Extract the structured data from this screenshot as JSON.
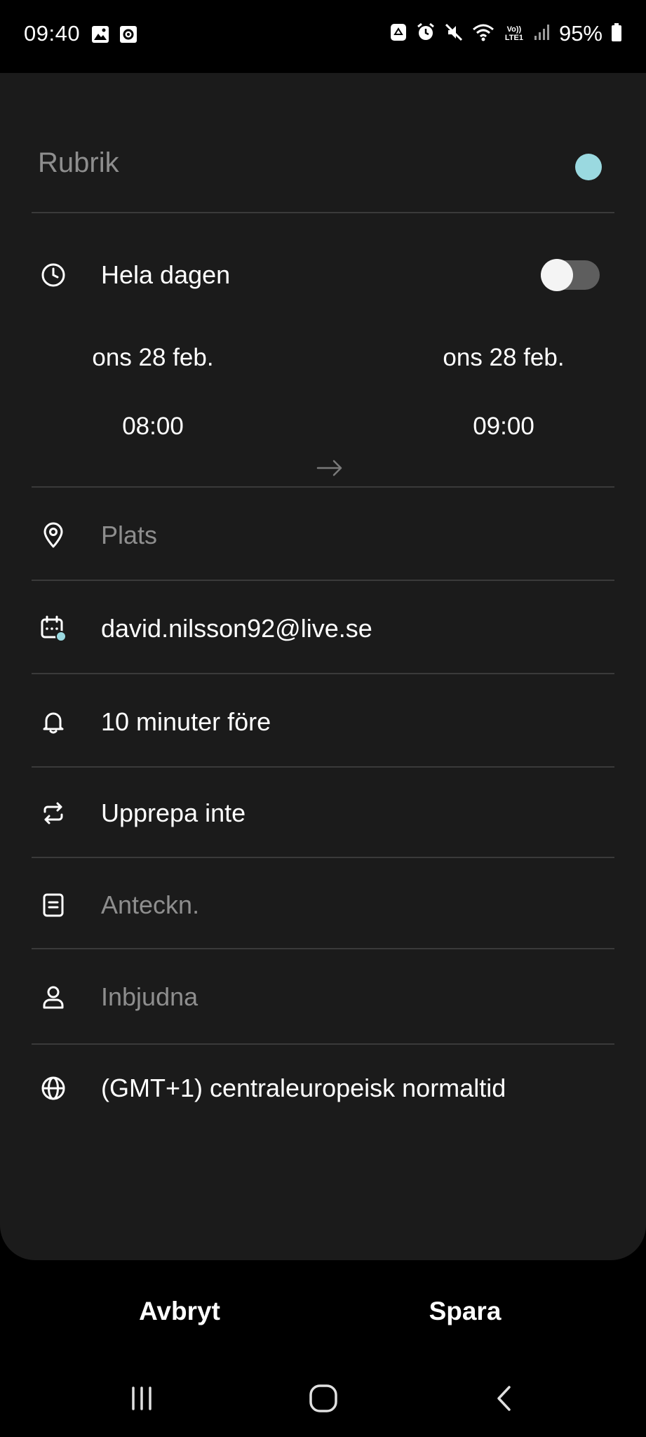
{
  "status_bar": {
    "time": "09:40",
    "battery": "95%",
    "left_icons": [
      "gallery-icon",
      "screen-record-icon"
    ],
    "right_icons": [
      "recycle-icon",
      "alarm-icon",
      "mute-icon",
      "wifi-icon",
      "volte-lte-icon",
      "signal-icon",
      "battery-icon"
    ],
    "volte_label": "Vo)) LTE1"
  },
  "event": {
    "title_placeholder": "Rubrik",
    "color": "#9ad9e0",
    "all_day": {
      "label": "Hela dagen",
      "enabled": false
    },
    "start": {
      "date": "ons 28 feb.",
      "time": "08:00"
    },
    "end": {
      "date": "ons 28 feb.",
      "time": "09:00"
    },
    "location_placeholder": "Plats",
    "calendar_account": "david.nilsson92@live.se",
    "reminder": "10 minuter före",
    "repeat": "Upprepa inte",
    "notes_placeholder": "Anteckn.",
    "invitees_placeholder": "Inbjudna",
    "timezone": "(GMT+1) centraleuropeisk normaltid"
  },
  "actions": {
    "cancel_label": "Avbryt",
    "save_label": "Spara"
  },
  "nav_bar": {
    "buttons": [
      "recent-apps-icon",
      "home-icon",
      "back-icon"
    ]
  },
  "colors": {
    "background": "#000000",
    "sheet": "#1b1b1b",
    "divider": "#3a3a3a",
    "placeholder": "#8e8e8e",
    "accent": "#9ad9e0"
  }
}
